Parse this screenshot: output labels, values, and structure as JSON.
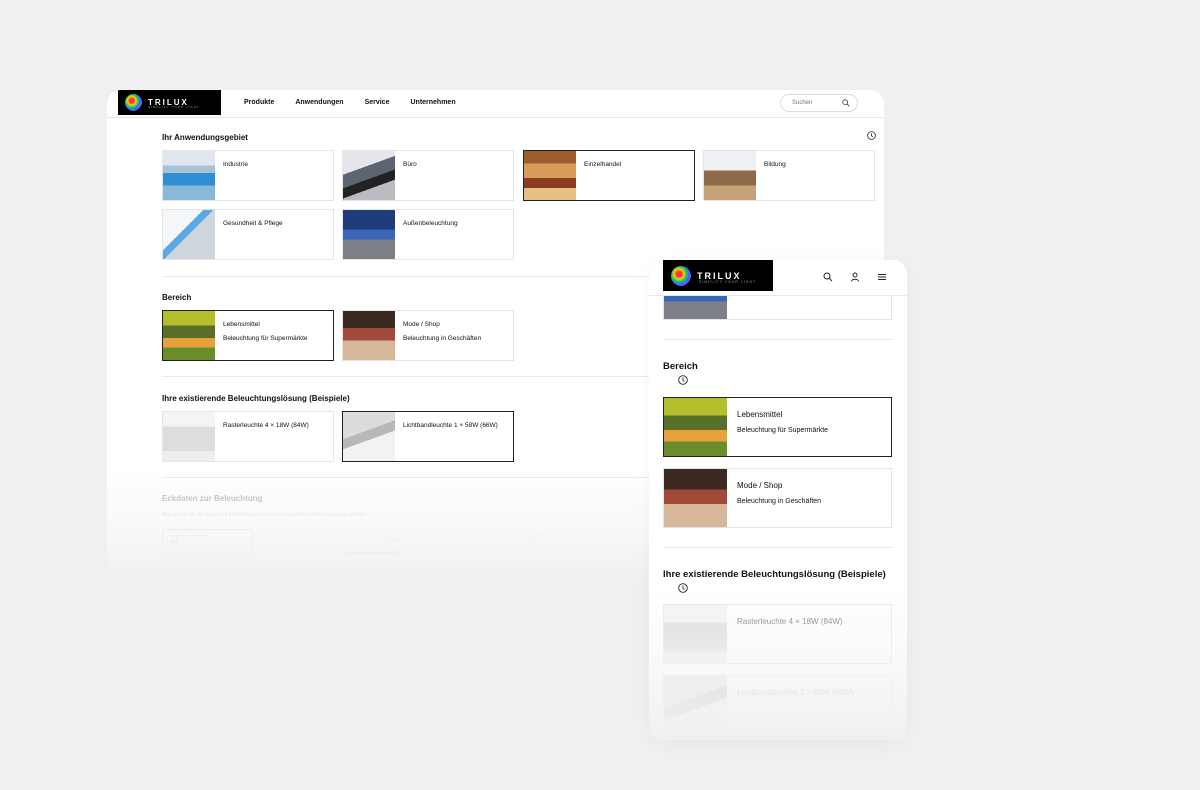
{
  "brand": {
    "logo_word": "TRILUX",
    "tagline": "SIMPLIFY YOUR LIGHT"
  },
  "desktop": {
    "nav": [
      "Produkte",
      "Anwendungen",
      "Service",
      "Unternehmen"
    ],
    "search_placeholder": "Suchen",
    "sections": {
      "anwendung": {
        "title": "Ihr Anwendungsgebiet",
        "tiles": [
          {
            "label": "Industrie",
            "selected": false
          },
          {
            "label": "Büro",
            "selected": false
          },
          {
            "label": "Einzelhandel",
            "selected": true
          },
          {
            "label": "Bildung",
            "selected": false
          },
          {
            "label": "Gesundheit & Pflege",
            "selected": false
          },
          {
            "label": "Außenbeleuchtung",
            "selected": false
          }
        ]
      },
      "bereich": {
        "title": "Bereich",
        "tiles": [
          {
            "label": "Lebensmittel",
            "sub": "Beleuchtung für Supermärkte",
            "selected": true
          },
          {
            "label": "Mode / Shop",
            "sub": "Beleuchtung in Geschäften",
            "selected": false
          }
        ]
      },
      "loesung": {
        "title": "Ihre existierende Beleuchtungslösung (Beispiele)",
        "tiles": [
          {
            "label": "Rasterleuchte 4 × 18W (84W)",
            "selected": false
          },
          {
            "label": "Lichtbandleuchte 1 × 58W (66W)",
            "selected": true
          }
        ]
      },
      "eckdaten": {
        "title": "Eckdaten zur Beleuchtung",
        "hint": "Bitte geben Sie die folgenden Informationen an um Ihre persönliche Berechnung zu erhalten.",
        "field_label": "Anzahl der Leuchten",
        "field_value": "84",
        "slider_label": "30 ct/kWh",
        "third_label": "Laufzeit",
        "third_value": "30"
      }
    }
  },
  "mobile": {
    "bereich": {
      "title": "Bereich",
      "tiles": [
        {
          "label": "Lebensmittel",
          "sub": "Beleuchtung für Supermärkte",
          "selected": true
        },
        {
          "label": "Mode / Shop",
          "sub": "Beleuchtung in Geschäften",
          "selected": false
        }
      ]
    },
    "loesung": {
      "title": "Ihre existierende Beleuchtungslösung (Beispiele)",
      "tiles": [
        {
          "label": "Rasterleuchte 4 × 18W (84W)"
        },
        {
          "label": "Lichtbandleuchte 1 × 58W (66W)"
        }
      ]
    }
  },
  "icons": {
    "search": "search-icon",
    "user": "user-icon",
    "menu": "menu-icon",
    "info": "info-icon"
  }
}
